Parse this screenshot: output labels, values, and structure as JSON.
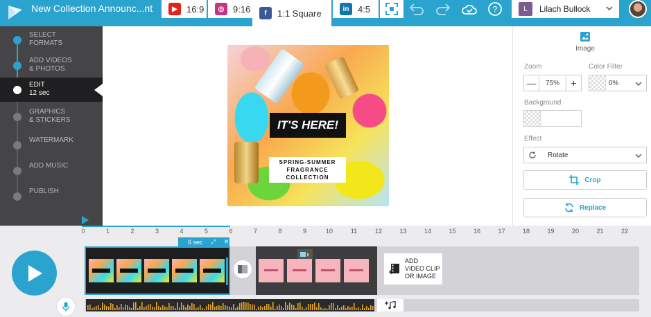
{
  "app": {
    "document_title": "New Collection Announc...nt"
  },
  "format_tabs": [
    {
      "icon": "youtube-icon",
      "label": "16:9",
      "color": "#e62117"
    },
    {
      "icon": "instagram-icon",
      "label": "9:16",
      "color": "#c13584"
    },
    {
      "icon": "facebook-icon",
      "label": "1:1 Square",
      "color": "#3b5998"
    },
    {
      "icon": "linkedin-icon",
      "label": "4:5",
      "color": "#0e76a8"
    }
  ],
  "user": {
    "initial": "L",
    "name": "Lilach Bullock"
  },
  "steps": [
    {
      "label": "SELECT\nFORMATS",
      "state": "done"
    },
    {
      "label": "ADD VIDEOS\n& PHOTOS",
      "state": "done"
    },
    {
      "label": "EDIT\n12 sec",
      "state": "active"
    },
    {
      "label": "GRAPHICS\n& STICKERS",
      "state": "todo"
    },
    {
      "label": "WATERMARK",
      "state": "todo"
    },
    {
      "label": "ADD MUSIC",
      "state": "todo"
    },
    {
      "label": "PUBLISH",
      "state": "todo"
    }
  ],
  "preview": {
    "headline": "IT'S HERE!",
    "subline": "SPRING-SUMMER\nFRAGRANCE\nCOLLECTION"
  },
  "panel": {
    "section_title": "Image",
    "zoom_label": "Zoom",
    "zoom_value": "75%",
    "zoom_minus": "—",
    "zoom_plus": "+",
    "filter_label": "Color Filter",
    "filter_value": "0%",
    "background_label": "Background",
    "effect_label": "Effect",
    "effect_value": "Rotate",
    "crop_label": "Crop",
    "replace_label": "Replace"
  },
  "timeline": {
    "ticks": [
      "0",
      "1",
      "2",
      "3",
      "4",
      "5",
      "6",
      "7",
      "8",
      "9",
      "10",
      "11",
      "12",
      "13",
      "14",
      "15",
      "16",
      "17",
      "18",
      "19",
      "20",
      "21",
      "22"
    ],
    "clip_duration": "6 sec",
    "clip_1_close": "✕",
    "add_clip_label": "ADD\nVIDEO CLIP\nOR IMAGE",
    "clip_1_thumbs": 5,
    "clip_2_thumbs": 4
  },
  "colors": {
    "accent": "#2aa3cf",
    "sidebar": "#454547"
  }
}
